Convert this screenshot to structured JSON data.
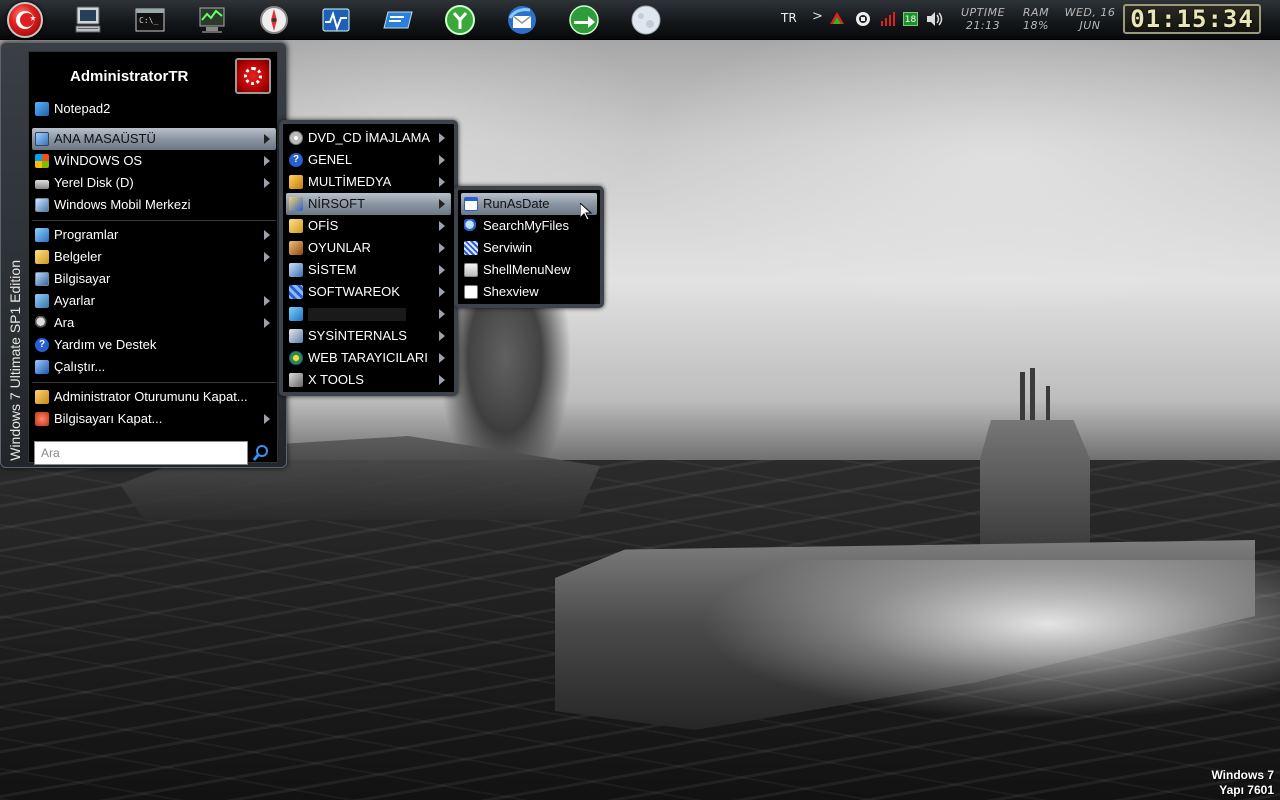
{
  "taskbar": {
    "quicklaunch": [
      {
        "name": "computer-icon"
      },
      {
        "name": "command-prompt-icon"
      },
      {
        "name": "system-monitor-icon"
      },
      {
        "name": "compass-icon"
      },
      {
        "name": "performance-monitor-icon"
      },
      {
        "name": "blue-window-icon"
      },
      {
        "name": "green-app-icon"
      },
      {
        "name": "thunderbird-icon"
      },
      {
        "name": "globe-arrow-icon"
      },
      {
        "name": "moon-icon"
      }
    ],
    "tray": {
      "language": "TR",
      "chevron": ">",
      "badge": "18",
      "uptime_label": "UPTIME",
      "uptime_value": "21:13",
      "ram_label": "RAM",
      "ram_value": "18%",
      "date_day": "WED, 16",
      "date_month": "JUN",
      "clock": "01:15:34"
    }
  },
  "start_menu": {
    "side_label": "Windows 7 Ultimate SP1 Edition",
    "username": "AdministratorTR",
    "items": [
      {
        "label": "Notepad2",
        "submenu": false
      },
      {
        "label": "ANA MASAÜSTÜ",
        "submenu": true,
        "selected": true
      },
      {
        "label": "WİNDOWS OS",
        "submenu": true
      },
      {
        "label": "Yerel Disk (D)",
        "submenu": true
      },
      {
        "label": "Windows Mobil Merkezi",
        "submenu": false
      },
      {
        "label": "Programlar",
        "submenu": true
      },
      {
        "label": "Belgeler",
        "submenu": true
      },
      {
        "label": "Bilgisayar",
        "submenu": false
      },
      {
        "label": "Ayarlar",
        "submenu": true
      },
      {
        "label": "Ara",
        "submenu": true
      },
      {
        "label": "Yardım ve Destek",
        "submenu": false
      },
      {
        "label": "Çalıştır...",
        "submenu": false
      },
      {
        "label": "Administrator Oturumunu Kapat...",
        "submenu": false
      },
      {
        "label": "Bilgisayarı Kapat...",
        "submenu": true
      }
    ],
    "search_placeholder": "Ara"
  },
  "submenu_desktop": {
    "items": [
      {
        "label": "DVD_CD İMAJLAMA"
      },
      {
        "label": "GENEL"
      },
      {
        "label": "MULTİMEDYA"
      },
      {
        "label": "NİRSOFT",
        "selected": true
      },
      {
        "label": "OFİS"
      },
      {
        "label": "OYUNLAR"
      },
      {
        "label": "SİSTEM"
      },
      {
        "label": "SOFTWAREOK"
      },
      {
        "label": ""
      },
      {
        "label": "SYSİNTERNALS"
      },
      {
        "label": "WEB TARAYICILARI"
      },
      {
        "label": "X TOOLS"
      }
    ]
  },
  "submenu_nirsoft": {
    "items": [
      {
        "label": "RunAsDate",
        "selected": true
      },
      {
        "label": "SearchMyFiles"
      },
      {
        "label": "Serviwin"
      },
      {
        "label": "ShellMenuNew"
      },
      {
        "label": "Shexview"
      }
    ]
  },
  "watermark": {
    "line1": "Windows 7",
    "line2": "Yapı 7601"
  },
  "colors": {
    "selection": "#8a96a3",
    "taskbar": "#15181b",
    "menu_bg": "#000000",
    "clock_text": "#e9e6b8"
  }
}
